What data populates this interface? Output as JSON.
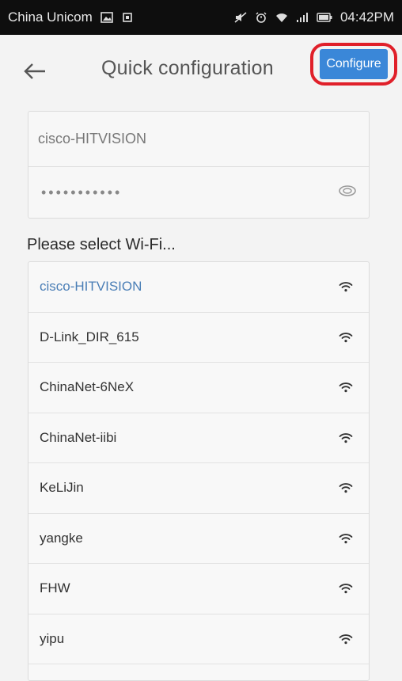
{
  "status_bar": {
    "carrier": "China Unicom",
    "time": "04:42PM"
  },
  "header": {
    "title": "Quick configuration",
    "configure_label": "Configure"
  },
  "credentials": {
    "ssid": "cisco-HITVISION",
    "password_masked": "•••••••••••"
  },
  "wifi_section_label": "Please select Wi-Fi...",
  "wifi_networks": [
    {
      "name": "cisco-HITVISION",
      "selected": true
    },
    {
      "name": "D-Link_DIR_615",
      "selected": false
    },
    {
      "name": "ChinaNet-6NeX",
      "selected": false
    },
    {
      "name": "ChinaNet-iibi",
      "selected": false
    },
    {
      "name": "KeLiJin",
      "selected": false
    },
    {
      "name": "yangke",
      "selected": false
    },
    {
      "name": "FHW",
      "selected": false
    },
    {
      "name": "yipu",
      "selected": false
    }
  ],
  "colors": {
    "accent": "#3a87d8",
    "highlight_ring": "#e0202a",
    "selected_text": "#4a7eb6",
    "status_bar": "#0e0e0e"
  }
}
